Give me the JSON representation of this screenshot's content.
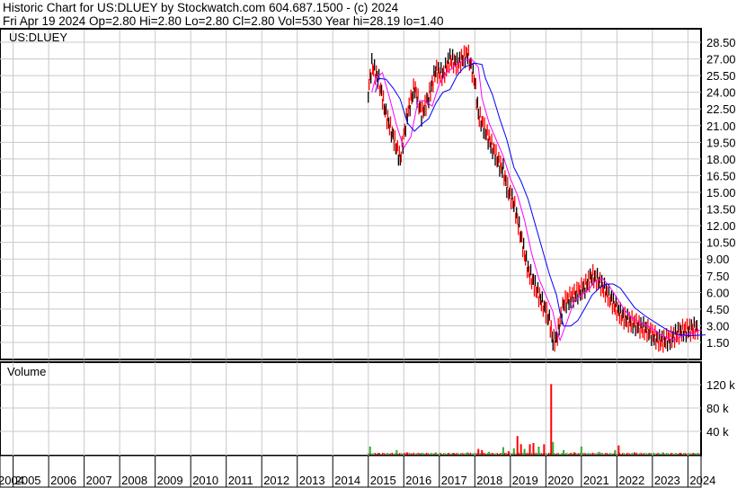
{
  "header": {
    "title": "Historic Chart for US:DLUEY by Stockwatch.com 604.687.1500 - (c) 2024",
    "quote": "Fri Apr 19 2024   Op=2.80   Hi=2.80   Lo=2.80   Cl=2.80   Vol=530   Year hi=28.19   lo=1.40"
  },
  "chart_data": {
    "type": "line",
    "title": "US:DLUEY",
    "volume_label": "Volume",
    "xlim": [
      2004.63,
      2024.37
    ],
    "ylim": [
      0.4,
      29.3
    ],
    "price_ticks": [
      "28.50",
      "27.00",
      "25.50",
      "24.00",
      "22.50",
      "21.00",
      "19.50",
      "18.00",
      "16.50",
      "15.00",
      "13.50",
      "12.00",
      "10.50",
      "9.00",
      "7.50",
      "6.00",
      "4.50",
      "3.00",
      "1.50"
    ],
    "volume_ticks": [
      "120 k",
      "80 k",
      "40 k"
    ],
    "volume_ylim": [
      0,
      160
    ],
    "years": [
      "2004",
      "2005",
      "2006",
      "2007",
      "2008",
      "2009",
      "2010",
      "2011",
      "2012",
      "2013",
      "2014",
      "2015",
      "2016",
      "2017",
      "2018",
      "2019",
      "2020",
      "2021",
      "2022",
      "2023",
      "2024"
    ],
    "price": [
      [
        2015.0,
        24
      ],
      [
        2015.1,
        26.5
      ],
      [
        2015.3,
        25
      ],
      [
        2015.5,
        22
      ],
      [
        2015.7,
        20
      ],
      [
        2015.9,
        18
      ],
      [
        2016.1,
        22
      ],
      [
        2016.3,
        24.5
      ],
      [
        2016.5,
        22
      ],
      [
        2016.7,
        23.5
      ],
      [
        2016.9,
        26
      ],
      [
        2017.1,
        25.5
      ],
      [
        2017.3,
        27
      ],
      [
        2017.5,
        26.5
      ],
      [
        2017.8,
        27.5
      ],
      [
        2018.0,
        25
      ],
      [
        2018.1,
        22
      ],
      [
        2018.3,
        20.5
      ],
      [
        2018.5,
        19
      ],
      [
        2018.7,
        17.5
      ],
      [
        2018.8,
        17
      ],
      [
        2018.9,
        15.5
      ],
      [
        2019.1,
        14
      ],
      [
        2019.3,
        11
      ],
      [
        2019.5,
        8
      ],
      [
        2019.7,
        6.5
      ],
      [
        2019.9,
        5
      ],
      [
        2020.1,
        3.5
      ],
      [
        2020.2,
        1.6
      ],
      [
        2020.3,
        1.8
      ],
      [
        2020.5,
        5
      ],
      [
        2020.7,
        5.5
      ],
      [
        2020.9,
        6
      ],
      [
        2021.1,
        6.5
      ],
      [
        2021.3,
        7.5
      ],
      [
        2021.5,
        7
      ],
      [
        2021.7,
        6
      ],
      [
        2021.9,
        5
      ],
      [
        2022.1,
        4
      ],
      [
        2022.3,
        3.5
      ],
      [
        2022.6,
        3
      ],
      [
        2022.9,
        2.5
      ],
      [
        2023.2,
        1.6
      ],
      [
        2023.5,
        1.8
      ],
      [
        2023.8,
        2.5
      ],
      [
        2024.3,
        2.8
      ]
    ],
    "volume": [
      [
        2015.05,
        14,
        "g"
      ],
      [
        2015.3,
        3,
        "r"
      ],
      [
        2015.8,
        8,
        "g"
      ],
      [
        2016.1,
        4,
        "r"
      ],
      [
        2016.5,
        3,
        "g"
      ],
      [
        2016.9,
        4,
        "g"
      ],
      [
        2017.4,
        3,
        "r"
      ],
      [
        2017.8,
        4,
        "g"
      ],
      [
        2018.1,
        10,
        "r"
      ],
      [
        2018.2,
        8,
        "r"
      ],
      [
        2018.4,
        5,
        "g"
      ],
      [
        2018.8,
        13,
        "g"
      ],
      [
        2018.95,
        6,
        "r"
      ],
      [
        2019.1,
        11,
        "g"
      ],
      [
        2019.2,
        32,
        "r"
      ],
      [
        2019.3,
        18,
        "r"
      ],
      [
        2019.4,
        10,
        "g"
      ],
      [
        2019.55,
        18,
        "r"
      ],
      [
        2019.65,
        20,
        "r"
      ],
      [
        2019.8,
        14,
        "g"
      ],
      [
        2019.95,
        18,
        "r"
      ],
      [
        2020.15,
        121,
        "r"
      ],
      [
        2020.2,
        22,
        "g"
      ],
      [
        2020.5,
        8,
        "g"
      ],
      [
        2020.8,
        4,
        "r"
      ],
      [
        2021.0,
        14,
        "g"
      ],
      [
        2021.5,
        5,
        "g"
      ],
      [
        2021.95,
        8,
        "g"
      ],
      [
        2022.05,
        16,
        "r"
      ],
      [
        2022.5,
        4,
        "r"
      ],
      [
        2022.9,
        3,
        "g"
      ],
      [
        2023.3,
        4,
        "g"
      ],
      [
        2023.8,
        3,
        "r"
      ],
      [
        2024.2,
        2,
        "g"
      ]
    ],
    "ma_short": "magenta",
    "ma_long": "blue",
    "colors": {
      "ma_short": "#ff00ff",
      "ma_long": "#0000ff",
      "up": "#33aa33",
      "down": "#ff0000",
      "grid": "#c8c8c8"
    }
  }
}
